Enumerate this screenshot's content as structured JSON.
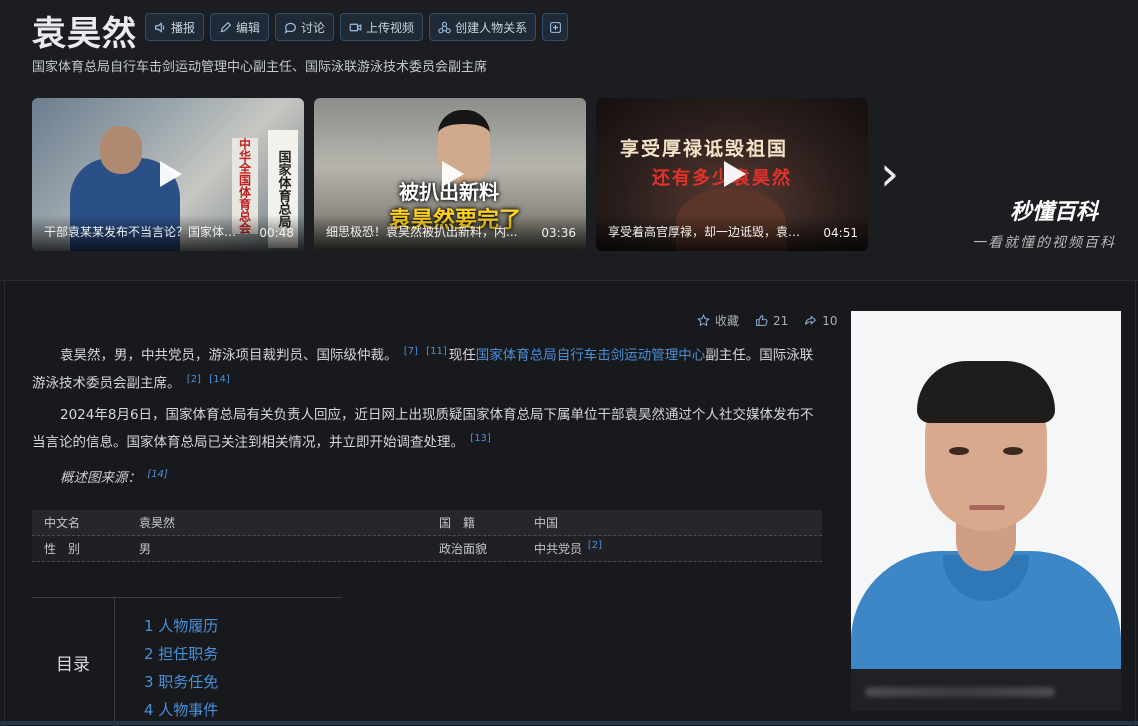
{
  "title": "袁昊然",
  "actions": {
    "broadcast": "播报",
    "edit": "编辑",
    "discuss": "讨论",
    "upload": "上传视频",
    "relation": "创建人物关系",
    "add": "+"
  },
  "subtitle": "国家体育总局自行车击剑运动管理中心副主任、国际泳联游泳技术委员会副主席",
  "videos": [
    {
      "caption": "干部袁某某发布不当言论？国家体育总局回应",
      "duration": "00:48",
      "overlay_1": "",
      "overlay_2": "",
      "sign": "国家体育总局",
      "sign2": "中华全国体育总会"
    },
    {
      "caption": "细思极恐！袁昊然被扒出新料，内...",
      "duration": "03:36",
      "overlay_1": "被扒出新料",
      "overlay_2": "袁昊然要完了"
    },
    {
      "caption": "享受着高官厚禄，却一边诋毁，袁昊...",
      "duration": "04:51",
      "overlay_1": "享受厚禄诋毁祖国",
      "overlay_2": "还有多少袁昊然"
    }
  ],
  "brand": {
    "name": "秒懂百科",
    "slogan": "一看就懂的视频百科"
  },
  "stats": {
    "collect": "收藏",
    "likes": "21",
    "shares": "10"
  },
  "intro": {
    "p1_a": "袁昊然，男，中共党员，游泳项目裁判员、国际级仲裁。",
    "p1_ref1": "[7]",
    "p1_ref2": "[11]",
    "p1_b": "现任",
    "p1_link": "国家体育总局自行车击剑运动管理中心",
    "p1_c": "副主任。国际泳联游泳技术委员会副主席。",
    "p1_ref3": "[2]",
    "p1_ref4": "[14]",
    "p2": "2024年8月6日，国家体育总局有关负责人回应，近日网上出现质疑国家体育总局下属单位干部袁昊然通过个人社交媒体发布不当言论的信息。国家体育总局已关注到相关情况，并立即开始调查处理。",
    "p2_ref": "[13]",
    "figure_source": "概述图来源：",
    "figure_ref": "[14]"
  },
  "infobox": [
    {
      "k1": "中文名",
      "v1": "袁昊然",
      "k2": "国　籍",
      "v2": "中国",
      "v2_link": true
    },
    {
      "k1": "性　别",
      "v1": "男",
      "k2": "政治面貌",
      "v2": "中共党员",
      "v2_ref": "[2]"
    }
  ],
  "toc": {
    "label": "目录",
    "items": [
      "1  人物履历",
      "2  担任职务",
      "3  职务任免",
      "4  人物事件"
    ]
  },
  "colors": {
    "link": "#4a8fd9",
    "background": "#1b1c20",
    "accent_border": "#2f4f6c"
  }
}
